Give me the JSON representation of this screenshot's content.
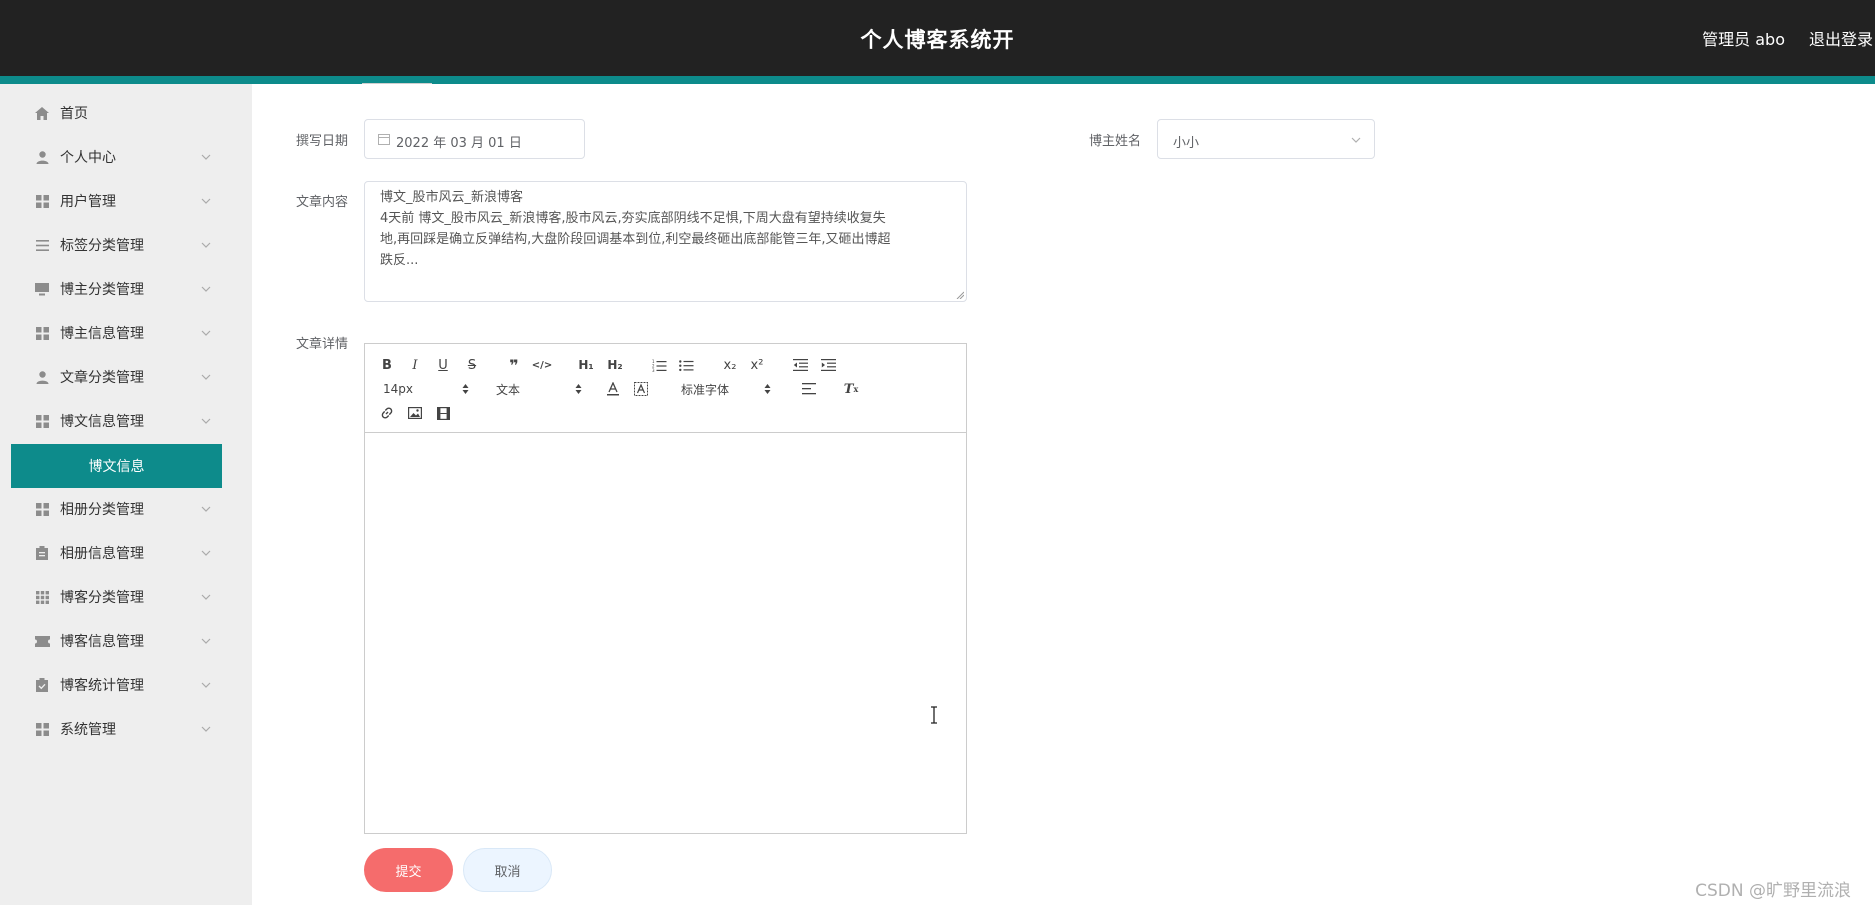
{
  "header": {
    "title": "个人博客系统开",
    "user": "管理员 abo",
    "logout": "退出登录"
  },
  "sidebar": {
    "items": [
      {
        "label": "首页",
        "icon": "home-icon"
      },
      {
        "label": "个人中心",
        "icon": "user-icon"
      },
      {
        "label": "用户管理",
        "icon": "grid-icon"
      },
      {
        "label": "标签分类管理",
        "icon": "list-icon"
      },
      {
        "label": "博主分类管理",
        "icon": "monitor-icon"
      },
      {
        "label": "博主信息管理",
        "icon": "grid-icon"
      },
      {
        "label": "文章分类管理",
        "icon": "user-icon"
      },
      {
        "label": "博文信息管理",
        "icon": "grid-icon"
      },
      {
        "label": "相册分类管理",
        "icon": "grid-icon"
      },
      {
        "label": "相册信息管理",
        "icon": "clipboard-icon"
      },
      {
        "label": "博客分类管理",
        "icon": "dots-grid-icon"
      },
      {
        "label": "博客信息管理",
        "icon": "ticket-icon"
      },
      {
        "label": "博客统计管理",
        "icon": "clipboard-check-icon"
      },
      {
        "label": "系统管理",
        "icon": "grid-icon"
      }
    ],
    "active_sub": "博文信息"
  },
  "form": {
    "date_label": "撰写日期",
    "date_value": "2022 年 03 月 01 日",
    "blogger_label": "博主姓名",
    "blogger_value": "小小",
    "content_label": "文章内容",
    "content_lines": [
      "博文_股市风云_新浪博客",
      "4天前 博文_股市风云_新浪博客,股市风云,夯实底部阴线不足惧,下周大盘有望持续收复失",
      "地,再回踩是确立反弹结构,大盘阶段回调基本到位,利空最终砸出底部能管三年,又砸出博超",
      "跌反..."
    ],
    "detail_label": "文章详情"
  },
  "editor": {
    "font_size": "14px",
    "block_type": "文本",
    "font_family": "标准字体"
  },
  "buttons": {
    "submit": "提交",
    "cancel": "取消"
  },
  "watermark": "CSDN @旷野里流浪",
  "colors": {
    "header_bg": "#222222",
    "accent": "#0d8b8b",
    "submit": "#f56c6c",
    "cancel_bg": "#ecf5ff"
  }
}
